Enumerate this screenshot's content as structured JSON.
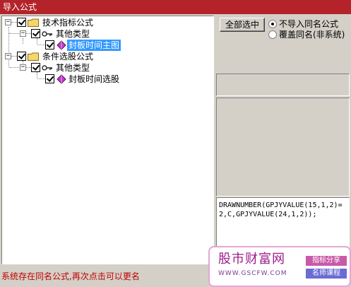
{
  "window": {
    "title": "导入公式"
  },
  "tree": {
    "nodes": [
      {
        "label": "技术指标公式",
        "type": "folder",
        "checked": true,
        "expanded": true
      },
      {
        "label": "其他类型",
        "type": "category",
        "checked": true,
        "expanded": true
      },
      {
        "label": "封板时间主图",
        "type": "formula",
        "checked": true,
        "selected": true
      },
      {
        "label": "条件选股公式",
        "type": "folder",
        "checked": true,
        "expanded": true
      },
      {
        "label": "其他类型",
        "type": "category",
        "checked": true,
        "expanded": true
      },
      {
        "label": "封板时间选股",
        "type": "formula",
        "checked": true,
        "selected": false
      }
    ]
  },
  "controls": {
    "select_all_label": "全部选中",
    "radio_skip_label": "不导入同名公式",
    "radio_overwrite_label": "覆盖同名(非系统)",
    "selected_radio": "radio_skip"
  },
  "code": {
    "text": "DRAWNUMBER(GPJYVALUE(15,1,2)=2,C,GPJYVALUE(24,1,2));"
  },
  "status": {
    "message": "系统存在同名公式,再次点击可以更名"
  },
  "watermark": {
    "brand": "股市财富网",
    "url": "WWW.GSCFW.COM",
    "tag1": "指标分享",
    "tag2": "名师课程"
  },
  "colors": {
    "titlebar": "#b4222a",
    "selection": "#3399ff",
    "status_text": "#c00000"
  }
}
